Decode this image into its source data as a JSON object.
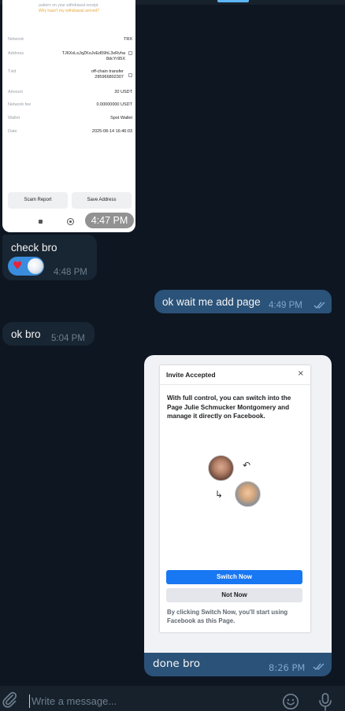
{
  "screenshot1": {
    "notice_line1": "pattern on your withdrawal receipt.",
    "notice_line2": "Why hasn't my withdrawal arrived?",
    "rows": [
      {
        "label": "Network",
        "value": "TRX"
      },
      {
        "label": "Address",
        "value": "TJ6XxLsJqZKoJvEd59hL3xRvha 8dcYr95X"
      },
      {
        "label": "Txid",
        "value": "off-chain transfer 285966802307"
      },
      {
        "label": "Amount",
        "value": "20 USDT"
      },
      {
        "label": "Network fee",
        "value": "0.00000000 USDT"
      },
      {
        "label": "Wallet",
        "value": "Spot Wallet"
      },
      {
        "label": "Date",
        "value": "2025-08-14 16:46:03"
      }
    ],
    "btn_scam": "Scam Report",
    "btn_save": "Save Address",
    "time": "4:47 PM"
  },
  "messages": [
    {
      "text": "check bro",
      "time": "4:48 PM"
    },
    {
      "text": "ok wait me add page",
      "time": "4:49 PM"
    },
    {
      "text": "ok bro",
      "time": "5:04 PM"
    },
    {
      "text": "done bro",
      "time": "8:26 PM"
    }
  ],
  "reaction": {
    "emoji": "♥"
  },
  "screenshot2": {
    "title": "Invite Accepted",
    "close": "×",
    "body": "With full control, you can switch into the Page Julie Schmucker Montgomery and manage it directly on Facebook.",
    "arrow_top": "↶",
    "arrow_bottom": "↳",
    "btn_switch": "Switch Now",
    "btn_not_now": "Not Now",
    "footer": "By clicking Switch Now, you'll start using Facebook as this Page."
  },
  "composer": {
    "placeholder": "Write a message..."
  },
  "colors": {
    "background": "#0e1621",
    "incoming_bubble": "#182533",
    "outgoing_bubble": "#2b5278",
    "accent": "#5eb5f7",
    "facebook_blue": "#1877f2"
  },
  "icons": [
    "paperclip-icon",
    "emoji-icon",
    "microphone-icon",
    "double-check-icon",
    "heart-icon",
    "close-icon"
  ]
}
